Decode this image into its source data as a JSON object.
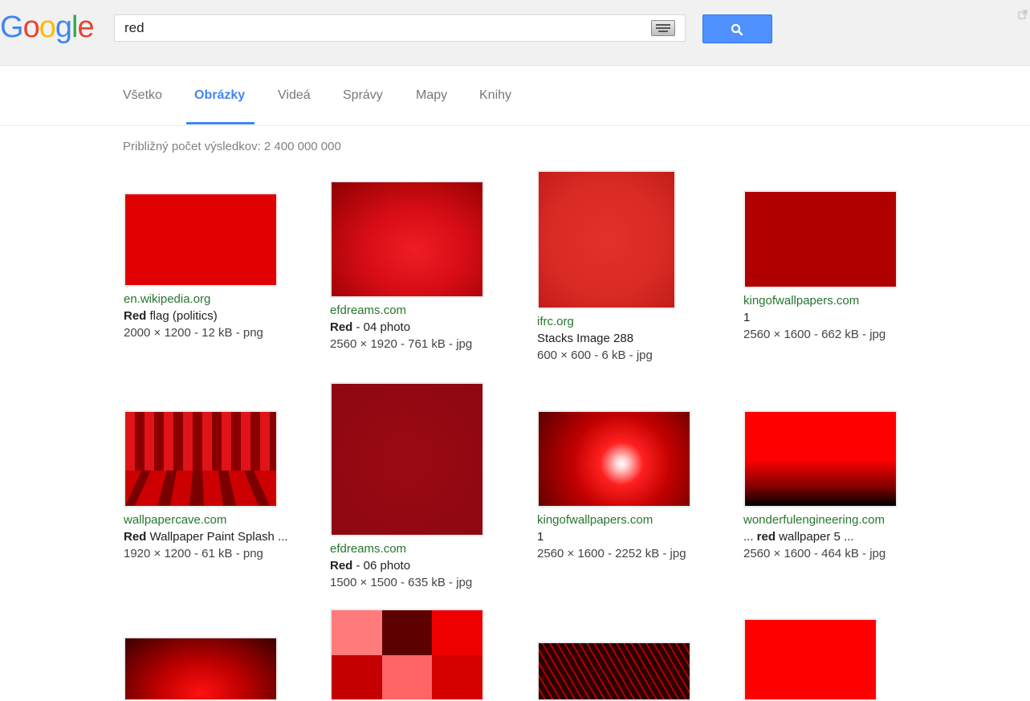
{
  "header": {
    "logo_letters": [
      "G",
      "o",
      "o",
      "g",
      "l",
      "e"
    ],
    "search_value": "red",
    "search_icon": "magnifier-icon",
    "keyboard_icon": "keyboard-icon"
  },
  "tabs": [
    {
      "label": "Všetko",
      "active": false
    },
    {
      "label": "Obrázky",
      "active": true
    },
    {
      "label": "Videá",
      "active": false
    },
    {
      "label": "Správy",
      "active": false
    },
    {
      "label": "Mapy",
      "active": false
    },
    {
      "label": "Knihy",
      "active": false
    }
  ],
  "result_stats": "Približný počet výsledkov: 2 400 000 000",
  "results": [
    {
      "domain": "en.wikipedia.org",
      "title_bold": "Red",
      "title_rest": " flag (politics)",
      "info": "2000 × 1200 - 12 kB - png"
    },
    {
      "domain": "efdreams.com",
      "title_bold": "Red",
      "title_rest": " - 04 photo",
      "info": "2560 × 1920 - 761 kB - jpg"
    },
    {
      "domain": "ifrc.org",
      "title_bold": "",
      "title_rest": "Stacks Image 288",
      "info": "600 × 600 - 6 kB - jpg"
    },
    {
      "domain": "kingofwallpapers.com",
      "title_bold": "",
      "title_rest": "1",
      "info": "2560 × 1600 - 662 kB - jpg"
    },
    {
      "domain": "wallpapercave.com",
      "title_bold": "Red",
      "title_rest": " Wallpaper Paint Splash ...",
      "info": "1920 × 1200 - 61 kB - png"
    },
    {
      "domain": "efdreams.com",
      "title_bold": "Red",
      "title_rest": " - 06 photo",
      "info": "1500 × 1500 - 635 kB - jpg"
    },
    {
      "domain": "kingofwallpapers.com",
      "title_bold": "",
      "title_rest": "1",
      "info": "2560 × 1600 - 2252 kB - jpg"
    },
    {
      "domain": "wonderfulengineering.com",
      "title_pre": "... ",
      "title_bold": "red",
      "title_rest": " wallpaper 5 ...",
      "info": "2560 × 1600 - 464 kB - jpg"
    }
  ],
  "colors": {
    "accent": "#4285f4",
    "domain_green": "#26762e",
    "search_button": "#4d90fe"
  }
}
